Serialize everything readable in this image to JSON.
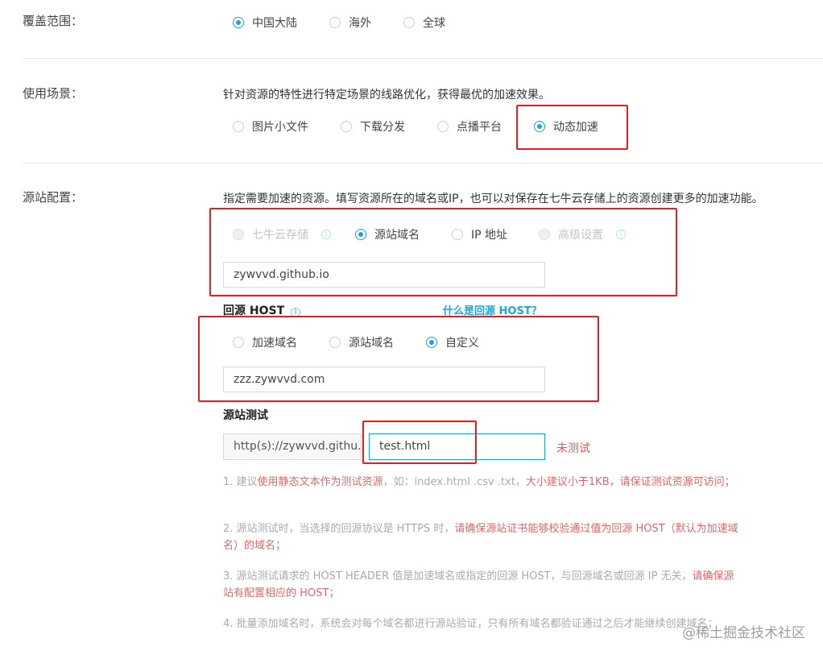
{
  "coverage": {
    "label": "覆盖范围：",
    "options": [
      "中国大陆",
      "海外",
      "全球"
    ]
  },
  "scenario": {
    "label": "使用场景：",
    "description": "针对资源的特性进行特定场景的线路优化，获得最优的加速效果。",
    "options": [
      "图片小文件",
      "下载分发",
      "点播平台",
      "动态加速"
    ]
  },
  "origin": {
    "label": "源站配置：",
    "description": "指定需要加速的资源。填写资源所在的域名或IP，也可以对保存在七牛云存储上的资源创建更多的加速功能。",
    "options": [
      "七牛云存储",
      "源站域名",
      "IP 地址",
      "高级设置"
    ],
    "domain_value": "zywvvd.github.io"
  },
  "host": {
    "title": "回源 HOST",
    "help_link": "什么是回源 HOST？",
    "options": [
      "加速域名",
      "源站域名",
      "自定义"
    ],
    "custom_value": "zzz.zywvvd.com"
  },
  "test": {
    "title": "源站测试",
    "prefix": "http(s)://zywvvd.githu...",
    "path_value": "test.html",
    "status": "未测试"
  },
  "notes": [
    {
      "p1": "1. 建议",
      "h1": "使用静态文本作为测试资源",
      "p2": "，如：index.html .csv .txt，",
      "h2": "大小建议小于1KB，请保证测试资源可访问；"
    },
    {
      "p1": "2. 源站测试时，当选择的回源协议是 HTTPS 时，",
      "h1": "请确保源站证书能够校验通过值为回源 HOST（默认为加速域名）的域名；"
    },
    {
      "p1": "3. 源站测试请求的 HOST HEADER 值是加速域名或指定的回源 HOST，与回源域名或回源 IP 无关，",
      "h1": "请确保源站有配置相应的 HOST；"
    },
    {
      "p1": "4. 批量添加域名时，系统会对每个域名都进行源站验证，只有所有域名都验证通过之后才能继续创建域名；"
    }
  ],
  "watermark": "@稀土掘金技术社区",
  "colors": {
    "accent": "#1aa6d8",
    "highlight_box": "#e02020",
    "warning_text": "#e0676a"
  }
}
